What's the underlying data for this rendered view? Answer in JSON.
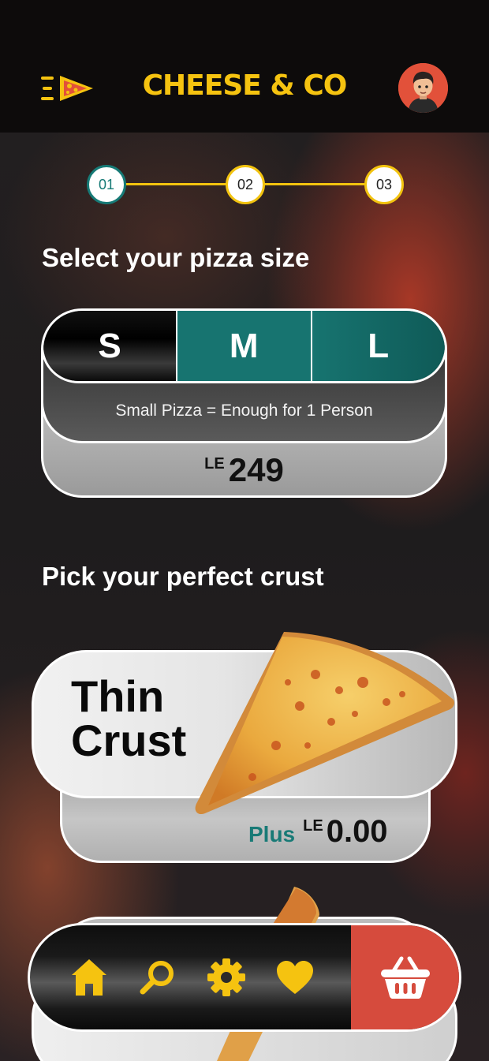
{
  "header": {
    "brand": "CHEESE & CO",
    "menu_icon": "pizza-menu-icon",
    "avatar_icon": "user-avatar"
  },
  "stepper": {
    "steps": [
      "01",
      "02",
      "03"
    ],
    "active_index": 0
  },
  "size_section": {
    "title": "Select your pizza size",
    "options": [
      "S",
      "M",
      "L"
    ],
    "selected": "S",
    "description": "Small Pizza = Enough for 1 Person",
    "currency": "LE",
    "price": "249"
  },
  "crust_section": {
    "title": "Pick your perfect crust",
    "crust_name": "Thin Crust",
    "plus_label": "Plus",
    "currency": "LE",
    "price": "0.00"
  },
  "bottom_nav": {
    "items": [
      "home-icon",
      "search-icon",
      "gear-icon",
      "heart-icon"
    ],
    "cart_icon": "basket-icon"
  },
  "colors": {
    "accent_yellow": "#f5c310",
    "teal": "#177470",
    "red": "#d64b3d",
    "header_bg": "#0d0b0b"
  }
}
